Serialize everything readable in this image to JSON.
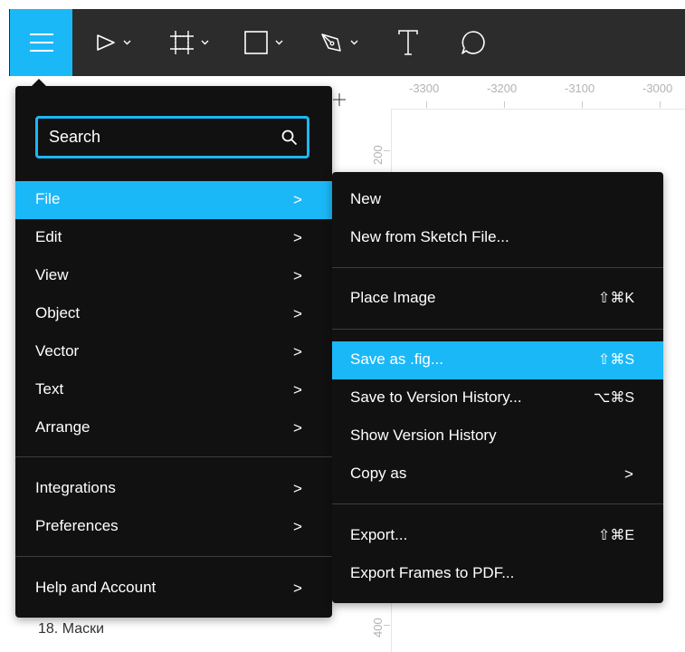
{
  "toolbar": {
    "tools": [
      {
        "name": "menu",
        "icon": "hamburger-icon"
      },
      {
        "name": "move",
        "icon": "pointer-icon"
      },
      {
        "name": "frame",
        "icon": "frame-icon"
      },
      {
        "name": "rectangle",
        "icon": "rectangle-icon"
      },
      {
        "name": "pen",
        "icon": "pen-icon"
      },
      {
        "name": "text",
        "icon": "text-icon"
      },
      {
        "name": "comment",
        "icon": "comment-icon"
      }
    ],
    "accent": "#1bb8f7",
    "background": "#2c2c2c"
  },
  "rulers": {
    "top_labels": [
      "-3300",
      "-3200",
      "-3100",
      "-3000"
    ],
    "left_labels": [
      "200",
      "400"
    ]
  },
  "layers": {
    "visible_item": "18. Маски"
  },
  "main_menu": {
    "search_placeholder": "Search",
    "items": [
      {
        "label": "File",
        "active": true
      },
      {
        "label": "Edit"
      },
      {
        "label": "View"
      },
      {
        "label": "Object"
      },
      {
        "label": "Vector"
      },
      {
        "label": "Text"
      },
      {
        "label": "Arrange"
      },
      {
        "label": "Integrations"
      },
      {
        "label": "Preferences"
      },
      {
        "label": "Help and Account"
      }
    ],
    "arrow": ">"
  },
  "file_menu": {
    "items": [
      {
        "label": "New",
        "shortcut": ""
      },
      {
        "label": "New from Sketch File...",
        "shortcut": ""
      },
      {
        "label": "Place Image",
        "shortcut": "⇧⌘K"
      },
      {
        "label": "Save as .fig...",
        "shortcut": "⇧⌘S",
        "active": true
      },
      {
        "label": "Save to Version History...",
        "shortcut": "⌥⌘S"
      },
      {
        "label": "Show Version History",
        "shortcut": ""
      },
      {
        "label": "Copy as",
        "shortcut": ">"
      },
      {
        "label": "Export...",
        "shortcut": "⇧⌘E"
      },
      {
        "label": "Export Frames to PDF...",
        "shortcut": ""
      }
    ]
  }
}
